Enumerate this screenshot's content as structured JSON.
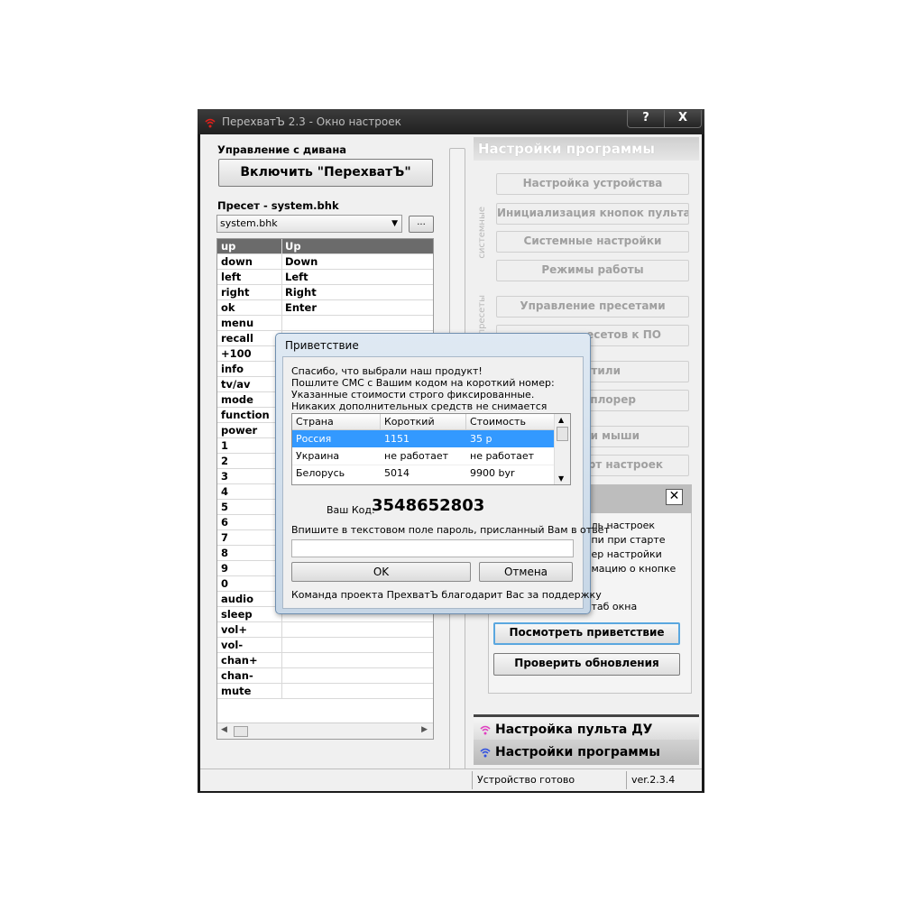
{
  "window": {
    "title": "ПерехватЪ 2.3 - Окно настроек",
    "help_label": "?",
    "close_label": "X"
  },
  "left": {
    "couch_label": "Управление с дивана",
    "enable_button": "Включить \"ПерехватЪ\"",
    "preset_label": "Пресет - system.bhk",
    "preset_select": "system.bhk",
    "preset_browse": "...",
    "keys": [
      {
        "key": "up",
        "value": "Up"
      },
      {
        "key": "down",
        "value": "Down"
      },
      {
        "key": "left",
        "value": "Left"
      },
      {
        "key": "right",
        "value": "Right"
      },
      {
        "key": "ok",
        "value": "Enter"
      },
      {
        "key": "menu",
        "value": ""
      },
      {
        "key": "recall",
        "value": ""
      },
      {
        "key": "+100",
        "value": ""
      },
      {
        "key": "info",
        "value": ""
      },
      {
        "key": "tv/av",
        "value": ""
      },
      {
        "key": "mode",
        "value": ""
      },
      {
        "key": "function",
        "value": ""
      },
      {
        "key": "power",
        "value": ""
      },
      {
        "key": "1",
        "value": ""
      },
      {
        "key": "2",
        "value": ""
      },
      {
        "key": "3",
        "value": ""
      },
      {
        "key": "4",
        "value": ""
      },
      {
        "key": "5",
        "value": ""
      },
      {
        "key": "6",
        "value": ""
      },
      {
        "key": "7",
        "value": ""
      },
      {
        "key": "8",
        "value": ""
      },
      {
        "key": "9",
        "value": ""
      },
      {
        "key": "0",
        "value": ""
      },
      {
        "key": "audio",
        "value": ""
      },
      {
        "key": "sleep",
        "value": ""
      },
      {
        "key": "vol+",
        "value": ""
      },
      {
        "key": "vol-",
        "value": ""
      },
      {
        "key": "chan+",
        "value": ""
      },
      {
        "key": "chan-",
        "value": ""
      },
      {
        "key": "mute",
        "value": ""
      }
    ]
  },
  "right": {
    "header": "Настройки программы",
    "system_label": "системные",
    "presets_label": "пресеты",
    "buttons": [
      "Настройка устройства",
      "Инициализация кнопок пульта ДУ",
      "Системные настройки",
      "Режимы работы",
      "Управление пресетами",
      "...есетов к ПО",
      "Стили",
      "...сплорер",
      "...йки мыши",
      "...порт настроек"
    ],
    "group_items": [
      "...ль настроек",
      "...пи при старте",
      "...ер настройки",
      "...мацию о кнопке",
      "...таб окна"
    ],
    "view_welcome": "Посмотреть приветствие",
    "check_updates": "Проверить обновления",
    "nav_remote": "Настройка пульта ДУ",
    "nav_program": "Настройки программы"
  },
  "status": {
    "text": "Устройство готово",
    "version": "ver.2.3.4"
  },
  "dialog": {
    "title": "Приветствие",
    "lines": [
      "Спасибо, что выбрали наш продукт!",
      "Пошлите СМС с Вашим кодом на короткий номер:",
      "Указанные стоимости строго фиксированные.",
      "Никаких дополнительных средств не снимается"
    ],
    "columns": [
      "Страна",
      "Короткий номер",
      "Стоимость"
    ],
    "rows": [
      [
        "Россия",
        "1151",
        "35 р"
      ],
      [
        "Украина",
        "не работает",
        "не работает"
      ],
      [
        "Белорусь",
        "5014",
        "9900 byr"
      ]
    ],
    "code_label": "Ваш Код:",
    "code_value": "3548652803",
    "password_prompt": "Впишите в текстовом поле пароль, присланный Вам в ответ",
    "password_value": "",
    "ok": "OK",
    "cancel": "Отмена",
    "thanks": "Команда проекта ПрехватЪ благодарит Вас за поддержку"
  },
  "colors": {
    "selection": "#3399ff",
    "selected_row": "#6b6b6b",
    "accent_focus": "#5aa7df",
    "icon_red": "#e0201a",
    "icon_magenta": "#e040c0",
    "icon_blue": "#3050e0"
  }
}
